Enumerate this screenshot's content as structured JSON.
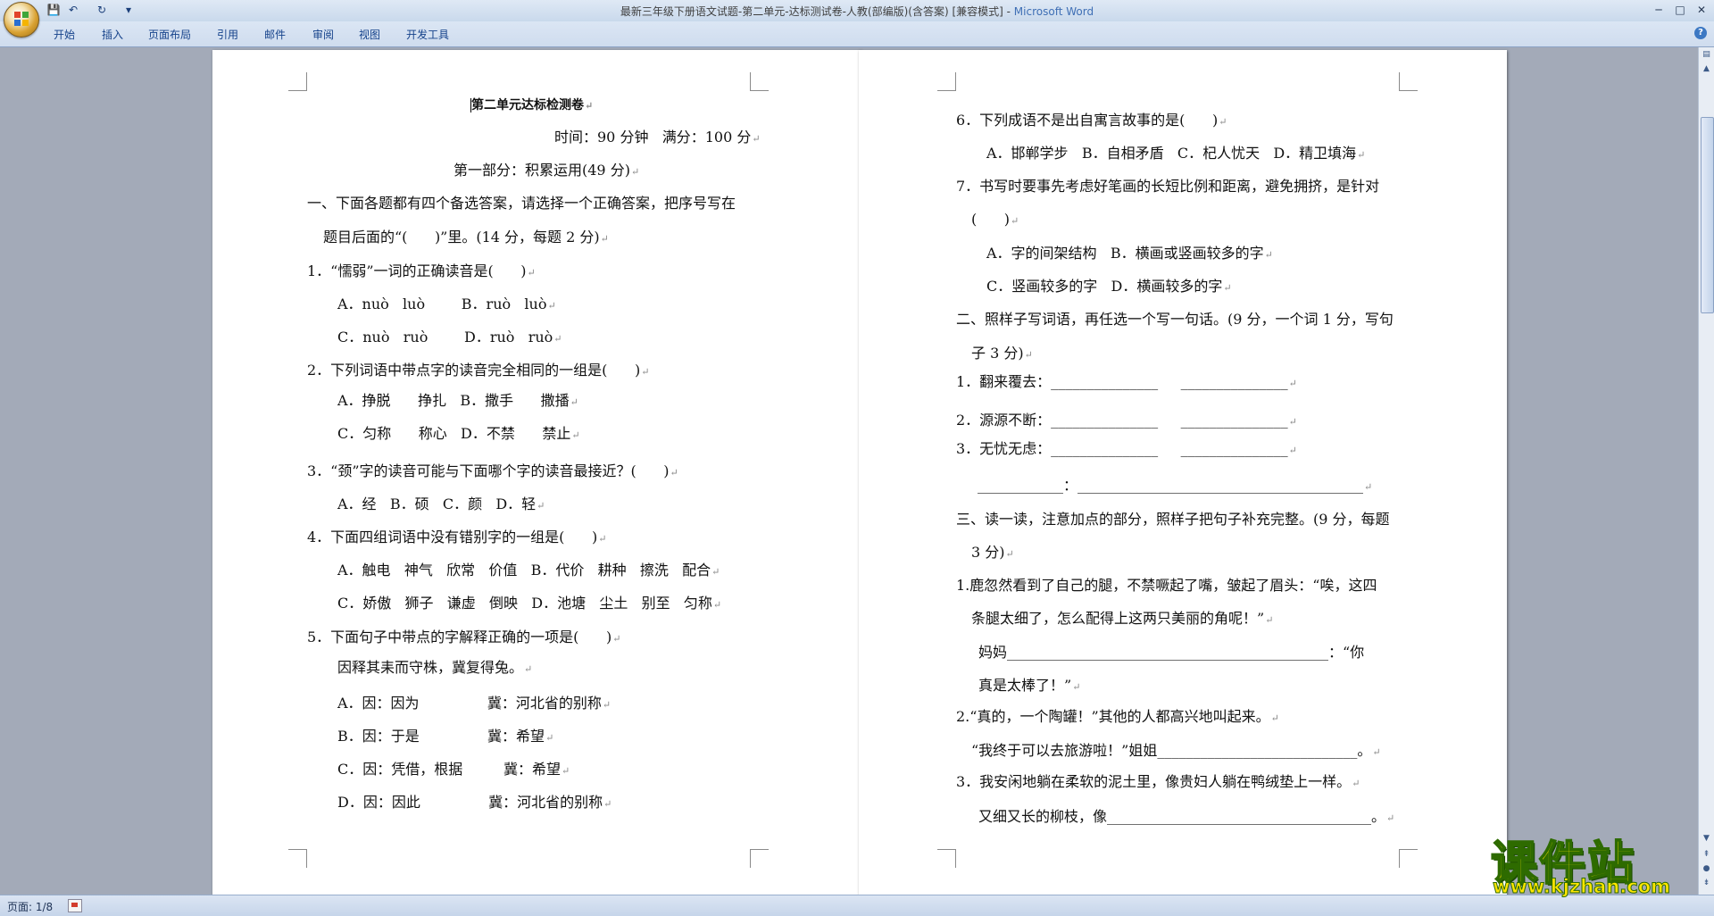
{
  "window": {
    "title": "最新三年级下册语文试题-第二单元-达标测试卷-人教(部编版)(含答案) [兼容模式]",
    "title_sep": " - ",
    "app_name": "Microsoft Word",
    "controls": {
      "minimize": "─",
      "maximize": "□",
      "close": "✕"
    }
  },
  "quick_access": {
    "save": "💾",
    "undo": "↶",
    "redo": "↻",
    "more": "▾"
  },
  "ribbon": {
    "tabs": [
      "开始",
      "插入",
      "页面布局",
      "引用",
      "邮件",
      "审阅",
      "视图",
      "开发工具"
    ],
    "help": "?"
  },
  "left_page": {
    "lines": [
      "第二单元达标检测卷",
      "时间：90 分钟   满分：100 分",
      "第一部分：积累运用(49 分)",
      "一、下面各题都有四个备选答案，请选择一个正确答案，把序号写在",
      "题目后面的“(      )”里。(14 分，每题 2 分)",
      "1．“懦弱”一词的正确读音是(      )",
      "A．nuò   luò        B．ruò   luò",
      "C．nuò   ruò        D．ruò   ruò",
      "2．下列词语中带点字的读音完全相同的一组是(      )",
      "A．挣脱      挣扎   B．撒手      撒播",
      "C．匀称      称心   D．不禁      禁止",
      "3．“颈”字的读音可能与下面哪个字的读音最接近？(      )",
      "A．经   B．硕   C．颜   D．轻",
      "4．下面四组词语中没有错别字的一组是(      )",
      "A．触电   神气   欣常   价值   B．代价   耕种   擦洗   配合",
      "C．娇傲   狮子   谦虚   倒映   D．池塘   尘土   别至   匀称",
      "5．下面句子中带点的字解释正确的一项是(      )",
      "因释其耒而守株，冀复得兔。",
      "A．因：因为               冀：河北省的别称",
      "B．因：于是               冀：希望",
      "C．因：凭借，根据         冀：希望",
      "D．因：因此               冀：河北省的别称"
    ]
  },
  "right_page": {
    "lines": [
      "6．下列成语不是出自寓言故事的是(      )",
      "A．邯郸学步   B．自相矛盾   C．杞人忧天   D．精卫填海",
      "7．书写时要事先考虑好笔画的长短比例和距离，避免拥挤，是针对",
      "(      )",
      "A．字的间架结构   B．横画或竖画较多的字",
      "C．竖画较多的字   D．横画较多的字",
      "二、照样子写词语，再任选一个写一句话。(9 分，一个词 1 分，写句",
      "子 3 分)",
      "1．翻来覆去：_______________     _______________",
      "2．源源不断：_______________     _______________",
      "3．无忧无虑：_______________     _______________",
      "____________：________________________________________",
      "三、读一读，注意加点的部分，照样子把句子补充完整。(9 分，每题",
      "3 分)",
      "1.鹿忽然看到了自己的腿，不禁噘起了嘴，皱起了眉头：“唉，这四",
      "条腿太细了，怎么配得上这两只美丽的角呢！”",
      "妈妈_____________________________________________：“你",
      "真是太棒了！”",
      "2.“真的，一个陶罐！”其他的人都高兴地叫起来。",
      "“我终于可以去旅游啦！”姐姐____________________________。",
      "3．我安闲地躺在柔软的泥土里，像贵妇人躺在鸭绒垫上一样。",
      "又细又长的柳枝，像_____________________________________。"
    ]
  },
  "status_bar": {
    "page_info": "页面: 1/8"
  },
  "watermark": {
    "name": "课件站",
    "url": "www.kjzhan.com"
  },
  "paragraph_mark": "↵"
}
